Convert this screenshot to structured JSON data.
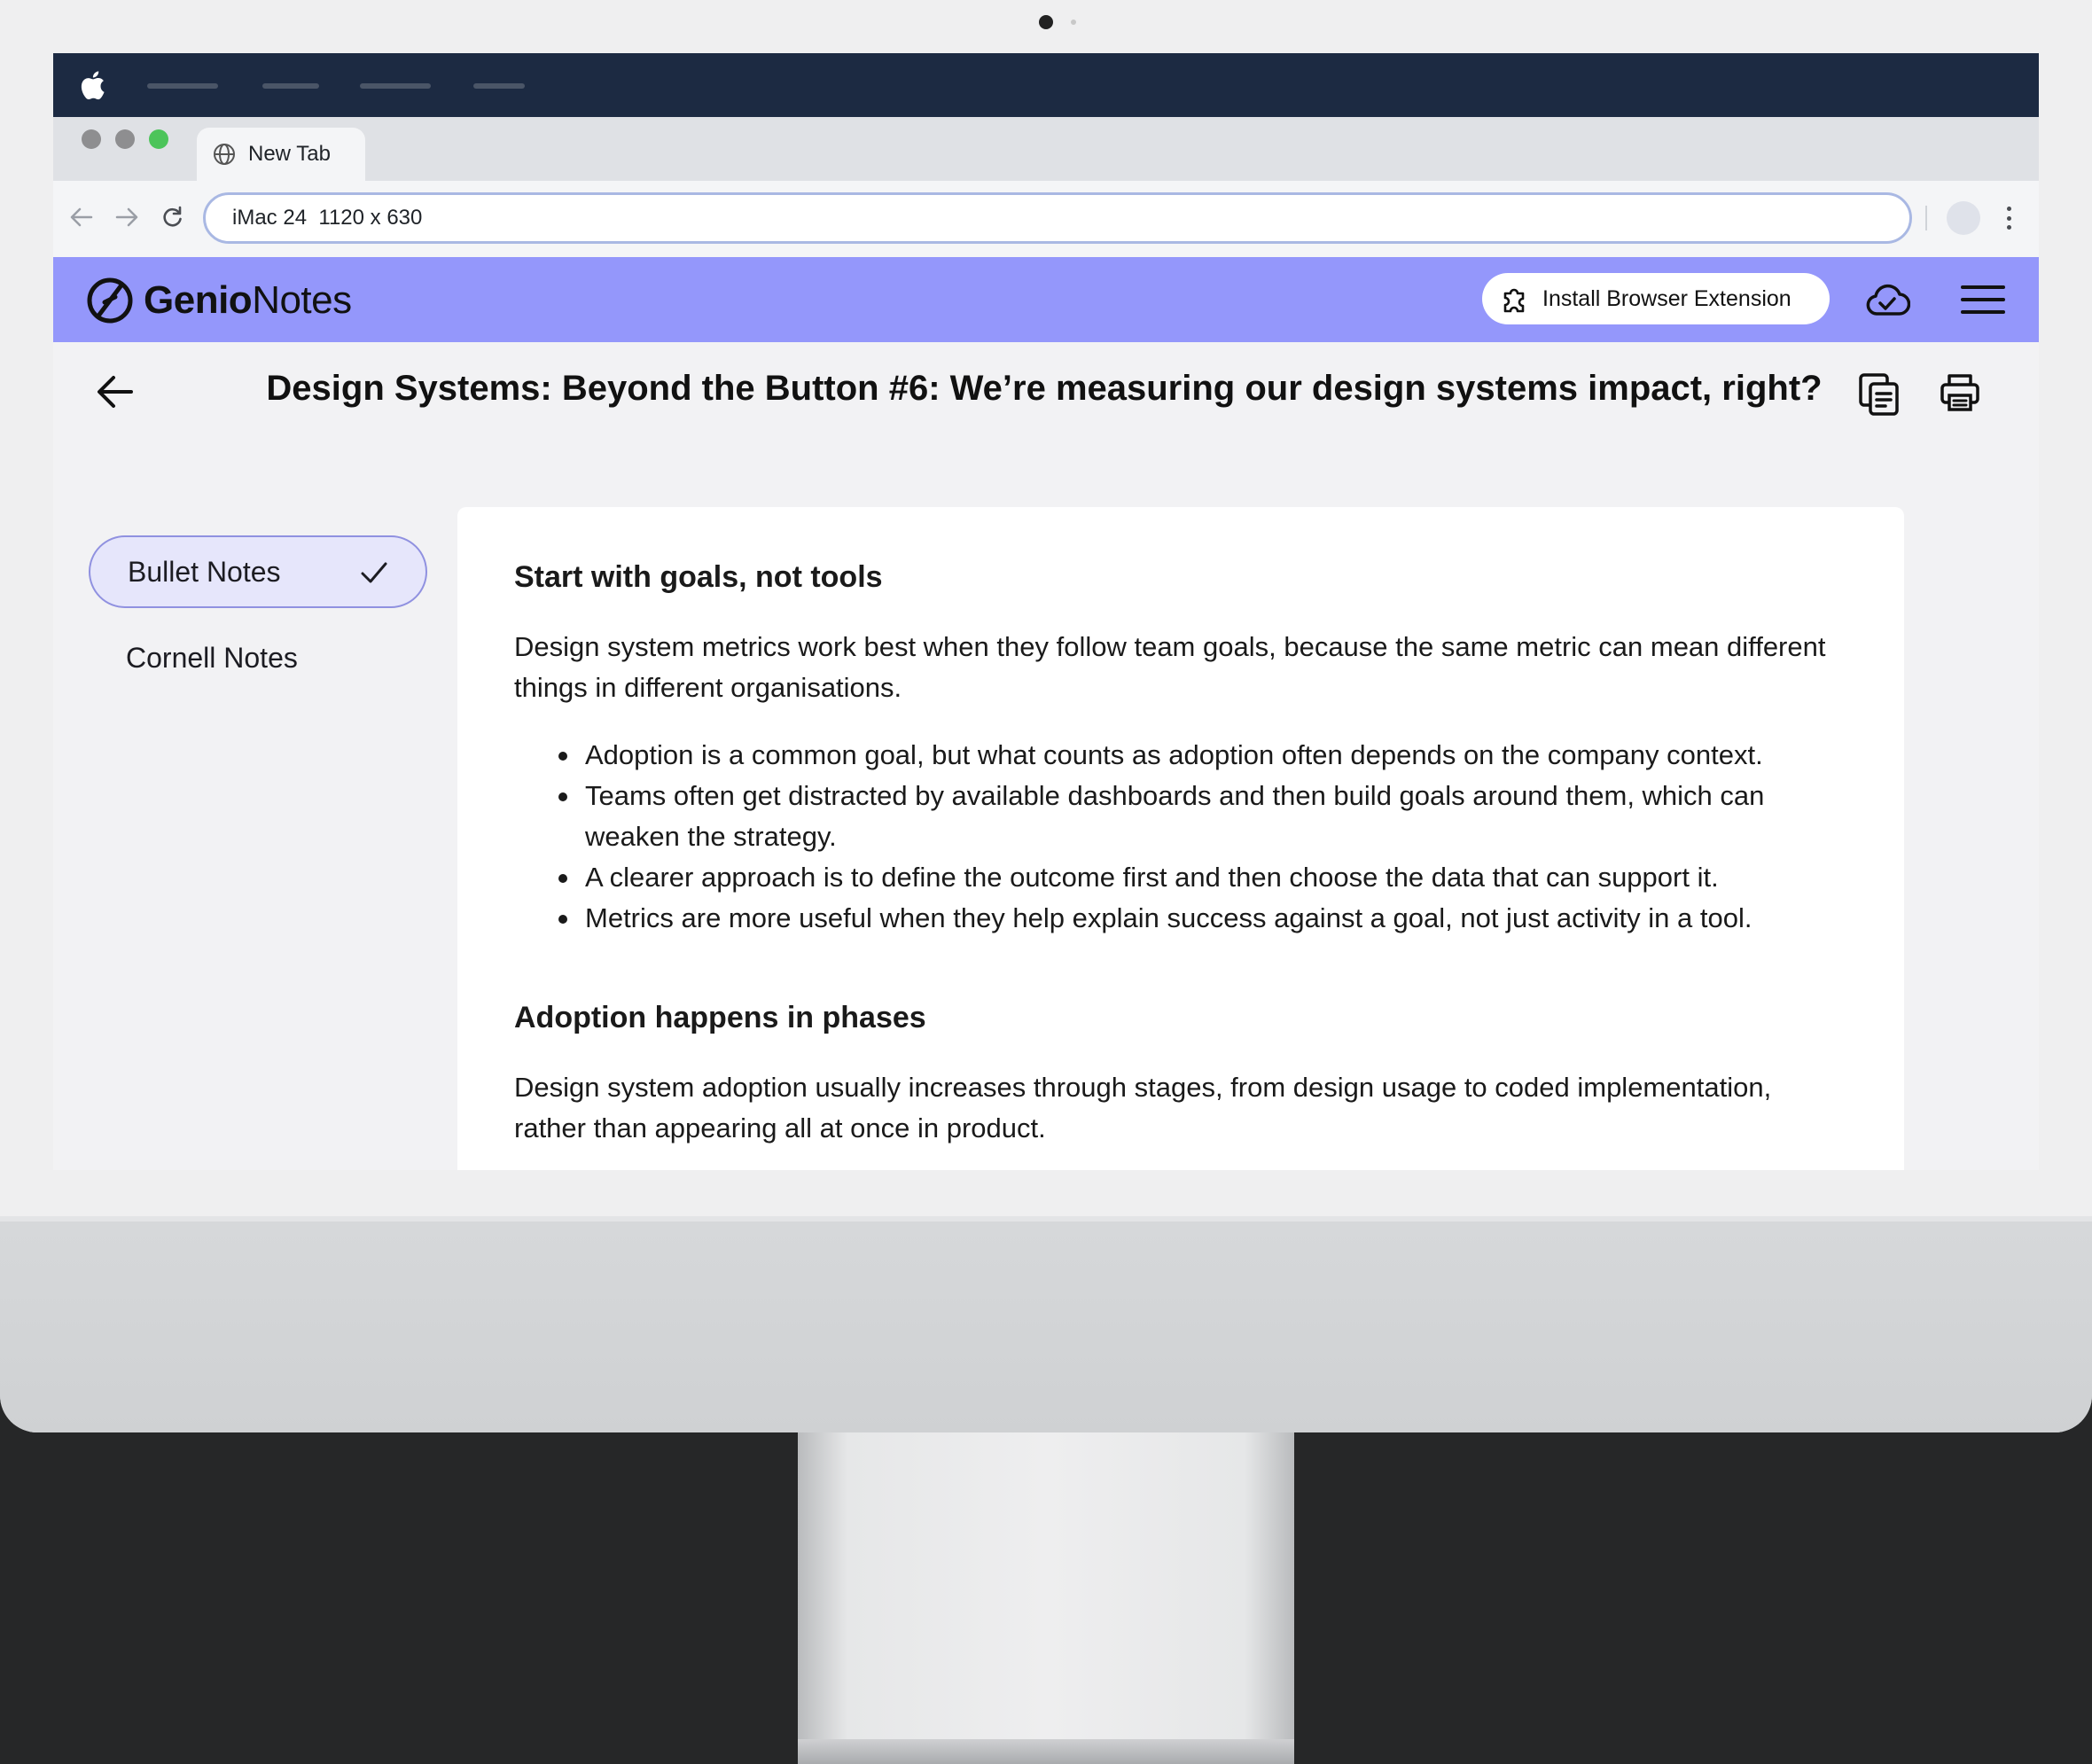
{
  "browser": {
    "tab_label": "New Tab",
    "url": "iMac 24  1120 x 630"
  },
  "app": {
    "logo_bold": "Genio",
    "logo_light": "Notes",
    "install_label": "Install Browser Extension",
    "header_color": "#9497fb"
  },
  "page": {
    "title": "Design Systems: Beyond the Button #6: We’re measuring our design systems impact, right?"
  },
  "sidebar": {
    "options": [
      {
        "label": "Bullet Notes",
        "selected": true
      },
      {
        "label": "Cornell Notes",
        "selected": false
      }
    ]
  },
  "content": {
    "sections": [
      {
        "heading": "Start with goals, not tools",
        "paragraph": "Design system metrics work best when they follow team goals, because the same metric can mean different things in different organisations.",
        "bullets": [
          "Adoption is a common goal, but what counts as adoption often depends on the company context.",
          "Teams often get distracted by available dashboards and then build goals around them, which can weaken the strategy.",
          "A clearer approach is to define the outcome first and then choose the data that can support it.",
          "Metrics are more useful when they help explain success against a goal, not just activity in a tool."
        ]
      },
      {
        "heading": "Adoption happens in phases",
        "paragraph": "Design system adoption usually increases through stages, from design usage to coded implementation, rather than appearing all at once in product."
      }
    ]
  },
  "icons": [
    "apple-icon",
    "globe-icon",
    "back-arrow-icon",
    "forward-arrow-icon",
    "reload-icon",
    "logo-icon",
    "puzzle-icon",
    "cloud-check-icon",
    "hamburger-icon",
    "arrow-left-icon",
    "copy-notes-icon",
    "printer-icon",
    "check-icon"
  ]
}
